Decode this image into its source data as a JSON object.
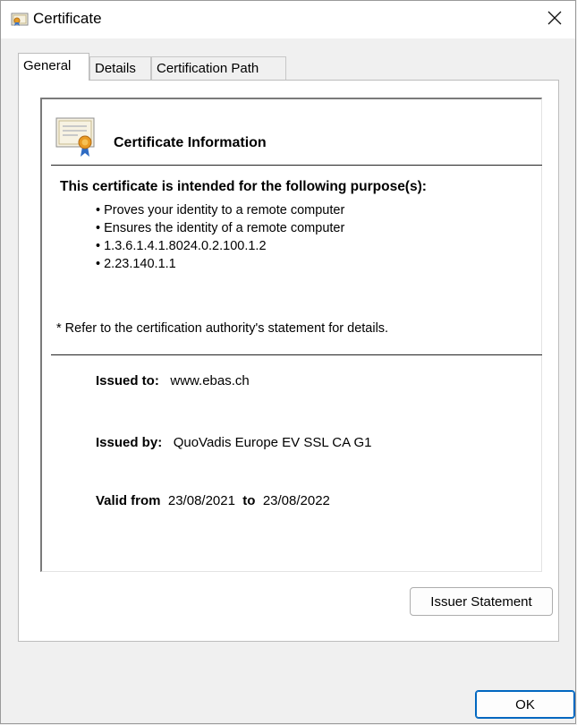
{
  "window": {
    "title": "Certificate"
  },
  "tabs": [
    {
      "label": "General",
      "active": true
    },
    {
      "label": "Details",
      "active": false
    },
    {
      "label": "Certification Path",
      "active": false
    }
  ],
  "general": {
    "heading": "Certificate Information",
    "purpose_title": "This certificate is intended for the following purpose(s):",
    "purposes": [
      "Proves your identity to a remote computer",
      "Ensures the identity of a remote computer",
      "1.3.6.1.4.1.8024.0.2.100.1.2",
      "2.23.140.1.1"
    ],
    "footnote": "* Refer to the certification authority's statement for details.",
    "issued_to_label": "Issued to:",
    "issued_to": "www.ebas.ch",
    "issued_by_label": "Issued by:",
    "issued_by": "QuoVadis Europe EV SSL CA G1",
    "valid_from_label": "Valid from",
    "valid_from": "23/08/2021",
    "to_label": "to",
    "valid_to": "23/08/2022"
  },
  "buttons": {
    "issuer_statement": "Issuer Statement",
    "ok": "OK"
  },
  "icons": {
    "window": "certificate-icon",
    "close": "close-icon",
    "cert": "certificate-icon"
  },
  "colors": {
    "accent": "#0067c0",
    "background": "#f0f0f0"
  }
}
